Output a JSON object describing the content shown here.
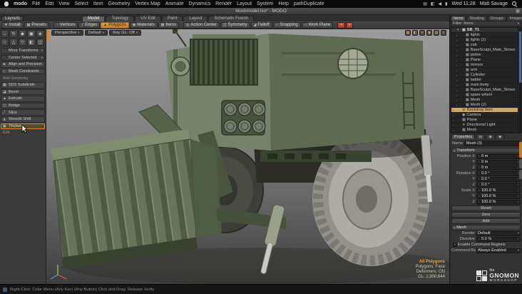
{
  "menubar": {
    "app_name": "modo",
    "menus": [
      "File",
      "Edit",
      "View",
      "Select",
      "Item",
      "Geometry",
      "Vertex Map",
      "Animate",
      "Dynamics",
      "Render",
      "Layout",
      "System",
      "Help",
      "pathDuplicate"
    ],
    "status_icons": [
      {
        "name": "keyboard-icon",
        "glyph": "▤"
      },
      {
        "name": "display-icon",
        "glyph": "◧"
      },
      {
        "name": "volume-icon",
        "glyph": "◀"
      },
      {
        "name": "battery-icon",
        "glyph": "▮"
      }
    ],
    "clock": "Wed 11:28",
    "user_name": "Matt Savage"
  },
  "titlebar": {
    "title": "blockmodel.lxo* - MODO",
    "corner_glyph": "▦"
  },
  "layoutbar": {
    "layouts_button": "Layouts",
    "tabs": [
      {
        "label": "Model",
        "active": true
      },
      {
        "label": "Topology"
      },
      {
        "label": "UV Edit"
      },
      {
        "label": "Paint"
      },
      {
        "label": "Layout"
      },
      {
        "label": "Schematic Fusion"
      }
    ]
  },
  "toolbar": {
    "left_buttons": [
      {
        "label": "Install",
        "glyph": "▼"
      },
      {
        "label": "Presets",
        "glyph": "▦"
      }
    ],
    "modes": [
      {
        "label": "Vertices",
        "glyph": "∵"
      },
      {
        "label": "Edges",
        "glyph": "╱"
      },
      {
        "label": "Polygons",
        "glyph": "▲",
        "active": true
      },
      {
        "label": "Materials",
        "glyph": "◉"
      },
      {
        "label": "Items",
        "glyph": "▦"
      }
    ],
    "tools": [
      {
        "label": "Action Center",
        "glyph": "◎"
      },
      {
        "label": "Symmetry",
        "glyph": "◫"
      },
      {
        "label": "Falloff",
        "glyph": "◢"
      },
      {
        "label": "Snapping",
        "glyph": "∩"
      },
      {
        "label": "Work Plane",
        "glyph": "▱"
      }
    ],
    "extra_buttons": [
      {
        "name": "paint-selection-icon",
        "glyph": "+",
        "cls": "red"
      },
      {
        "name": "lasso-selection-icon",
        "glyph": "▪",
        "cls": "red"
      }
    ]
  },
  "left_panel": {
    "tool_grid": [
      {
        "glyph": "↔"
      },
      {
        "glyph": "↻"
      },
      {
        "glyph": "◆"
      },
      {
        "glyph": "▣"
      },
      {
        "glyph": "◈"
      },
      {
        "glyph": "○"
      },
      {
        "glyph": "△"
      },
      {
        "glyph": "▽"
      },
      {
        "glyph": "◧"
      },
      {
        "glyph": "◫"
      }
    ],
    "rows": [
      {
        "label": "More Transforms",
        "type": "dropdown",
        "caret": "▾"
      },
      {
        "label": "Center Selected",
        "type": "dropdown",
        "caret": "▾"
      },
      {
        "label": "Align and Precision",
        "type": "tool",
        "glyph": "◈"
      },
      {
        "label": "Mesh Constraints",
        "type": "tool",
        "glyph": "◇"
      },
      {
        "label": "Add Geometry",
        "type": "header"
      },
      {
        "label": "SDS Subdivide",
        "type": "tool",
        "glyph": "▦"
      },
      {
        "label": "Bevel",
        "type": "tool",
        "glyph": "◪"
      },
      {
        "label": "Extrude",
        "type": "tool",
        "glyph": "▲"
      },
      {
        "label": "Bridge",
        "type": "tool",
        "glyph": "◫"
      },
      {
        "label": "Slice",
        "type": "tool",
        "glyph": "╱"
      },
      {
        "label": "Smooth Shift",
        "type": "tool",
        "glyph": "◮"
      },
      {
        "label": "Thicken",
        "type": "tool",
        "glyph": "▣",
        "active": true
      },
      {
        "label": "Edit",
        "type": "header"
      }
    ]
  },
  "viewport": {
    "controls": [
      {
        "label": "Perspective",
        "caret": "▾"
      },
      {
        "label": "Default",
        "caret": "▾"
      },
      {
        "label": "Ray GL: Off",
        "caret": "▾"
      }
    ],
    "icons": [
      {
        "name": "wireframe-icon",
        "glyph": "▦"
      },
      {
        "name": "shaded-icon",
        "glyph": "◧"
      },
      {
        "name": "lighting-icon",
        "glyph": "☀"
      },
      {
        "name": "camera-icon",
        "glyph": "◉"
      },
      {
        "name": "grid-icon",
        "glyph": "▤"
      },
      {
        "name": "viewport-options-icon",
        "glyph": "≡"
      }
    ],
    "stats": [
      {
        "label": "All Polygons"
      },
      {
        "label": "Polygons: Face"
      },
      {
        "label": "Deformers: ON"
      },
      {
        "label": "GL: 2,300,644"
      }
    ]
  },
  "right_panel": {
    "tabs": [
      {
        "label": "Items",
        "active": true
      },
      {
        "label": "Shading"
      },
      {
        "label": "Groups"
      },
      {
        "label": "Images"
      }
    ],
    "filter_label": "Filter: Items",
    "items": [
      {
        "label": "SB_T1",
        "type": "group",
        "arrow": "▾",
        "icon": "▣",
        "eye": "•"
      },
      {
        "label": "lights",
        "type": "mesh",
        "icon": "▦",
        "eye": "•",
        "indent": 1
      },
      {
        "label": "lights (2)",
        "type": "mesh",
        "icon": "▦",
        "eye": "•",
        "indent": 1
      },
      {
        "label": "cab",
        "type": "mesh",
        "icon": "▦",
        "eye": "•",
        "indent": 1
      },
      {
        "label": "BaseSculpt_Male_Shoes",
        "type": "mesh",
        "icon": "▦",
        "eye": "•",
        "indent": 1
      },
      {
        "label": "piston",
        "type": "mesh",
        "icon": "▦",
        "eye": "•",
        "indent": 1
      },
      {
        "label": "Plane",
        "type": "mesh",
        "icon": "▦",
        "eye": "•",
        "indent": 1
      },
      {
        "label": "mirrors",
        "type": "mesh",
        "icon": "▦",
        "eye": "•",
        "indent": 1
      },
      {
        "label": "arm",
        "type": "mesh",
        "icon": "▦",
        "eye": "•",
        "indent": 1
      },
      {
        "label": "Cylinder",
        "type": "mesh",
        "icon": "▦",
        "eye": "•",
        "indent": 1
      },
      {
        "label": "ladder",
        "type": "mesh",
        "icon": "▦",
        "eye": "•",
        "indent": 1
      },
      {
        "label": "main body",
        "type": "mesh",
        "icon": "▦",
        "eye": "•",
        "indent": 1
      },
      {
        "label": "BaseSculpt_Male_Shoes",
        "type": "mesh",
        "icon": "▦",
        "eye": "•",
        "indent": 1
      },
      {
        "label": "spare wheel",
        "type": "mesh",
        "icon": "▦",
        "eye": "•",
        "indent": 1
      },
      {
        "label": "Mesh",
        "type": "mesh",
        "icon": "▦",
        "eye": "•",
        "indent": 1
      },
      {
        "label": "Mesh (2)",
        "type": "mesh",
        "icon": "▦",
        "eye": "•",
        "indent": 1
      },
      {
        "label": "Backdrop Item",
        "type": "backdrop",
        "icon": "▣",
        "eye": "•",
        "selected": true
      },
      {
        "label": "Camera",
        "type": "camera",
        "icon": "◉",
        "eye": "•"
      },
      {
        "label": "Plane",
        "type": "mesh",
        "icon": "▦",
        "eye": "•"
      },
      {
        "label": "Directional Light",
        "type": "light",
        "icon": "☀",
        "eye": "•"
      },
      {
        "label": "Mesh",
        "type": "mesh",
        "icon": "▦",
        "eye": "•"
      }
    ]
  },
  "properties": {
    "tabs": [
      {
        "label": "Properties",
        "active": true
      },
      {
        "label": "▤"
      },
      {
        "label": "◉"
      },
      {
        "label": "◆"
      }
    ],
    "name_label": "Name",
    "name_value": "Mesh (3)",
    "transform": {
      "header": "Transform",
      "rows": [
        {
          "label": "Position X",
          "value": "0 m"
        },
        {
          "label": "Y",
          "value": "0 m"
        },
        {
          "label": "Z",
          "value": "0 m"
        },
        {
          "label": "Rotation X",
          "value": "0.0 °"
        },
        {
          "label": "Y",
          "value": "0.0 °"
        },
        {
          "label": "Z",
          "value": "0.0 °"
        },
        {
          "label": "Scale X",
          "value": "100.0 %"
        },
        {
          "label": "Y",
          "value": "100.0 %"
        },
        {
          "label": "Z",
          "value": "100.0 %"
        }
      ],
      "buttons": [
        {
          "label": "Reset"
        },
        {
          "label": "Zero"
        },
        {
          "label": "Add"
        }
      ]
    },
    "mesh_section": {
      "header": "Mesh",
      "render_label": "Render",
      "render_value": "Default",
      "dissolve_label": "Dissolve",
      "dissolve_value": "0.0 %",
      "enable_cr_label": "Enable Command Regions",
      "cr_label": "Command Regions",
      "cr_value": "Always Enabled"
    }
  },
  "statusbar": {
    "help": "Right-Click: Color Menu     (Any Key) (Any Button) Click and Drag: Release Verify"
  },
  "gnomon": {
    "the": "the",
    "name": "GNOMON",
    "workshop": "WORKSHOP"
  },
  "icons": {
    "caret": "▾",
    "check": "✓",
    "spin_l": "‹",
    "spin_r": "›"
  }
}
